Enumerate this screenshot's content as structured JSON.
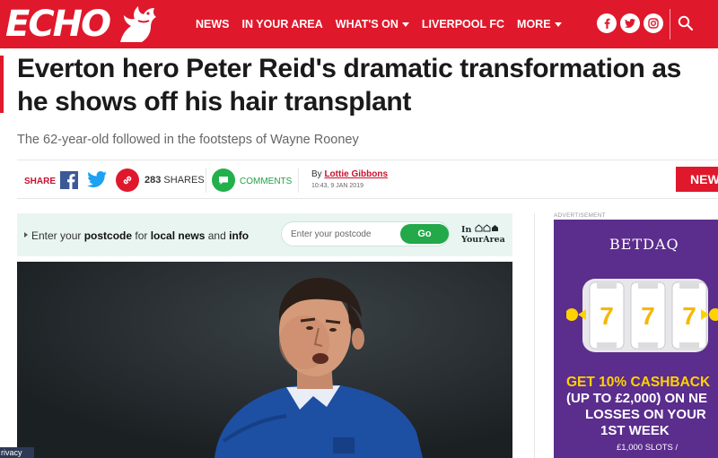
{
  "header": {
    "logo_text": "ECHO",
    "nav": [
      {
        "label": "NEWS",
        "has_menu": false
      },
      {
        "label": "IN YOUR AREA",
        "has_menu": false
      },
      {
        "label": "WHAT'S ON",
        "has_menu": true
      },
      {
        "label": "LIVERPOOL FC",
        "has_menu": false
      },
      {
        "label": "MORE",
        "has_menu": true
      }
    ],
    "social_icons": [
      "facebook-icon",
      "twitter-icon",
      "instagram-icon"
    ],
    "search_icon": "search-icon",
    "brand_color": "#e0182b"
  },
  "article": {
    "headline": "Everton hero Peter Reid's dramatic transformation as he shows off his hair transplant",
    "standfirst": "The 62-year-old followed in the footsteps of Wayne Rooney",
    "share_label": "SHARE",
    "share_count": "283",
    "share_count_suffix": "SHARES",
    "comments_label": "COMMENTS",
    "byline_prefix": "By",
    "author": "Lottie Gibbons",
    "date": "10:43, 9 JAN 2019",
    "news_tab": "NEW"
  },
  "postcode_widget": {
    "text_parts": {
      "a": "Enter your ",
      "b": "postcode",
      "c": " for ",
      "d": "local news",
      "e": " and ",
      "f": "info"
    },
    "placeholder": "Enter your postcode",
    "button_label": "Go",
    "brand_line1": "In",
    "brand_line2": "YourArea"
  },
  "privacy_label": "rivacy",
  "ad": {
    "label": "ADVERTISEMENT",
    "brand": "BETDAQ",
    "offer_line1": "GET 10% CASHBACK",
    "offer_line2": "(UP TO £2,000) ON NE",
    "offer_line3": "LOSSES ON YOUR",
    "offer_line4": "1ST WEEK",
    "small_line1": "£1,000 SLOTS /",
    "slot_digits": [
      "7",
      "7",
      "7"
    ]
  }
}
